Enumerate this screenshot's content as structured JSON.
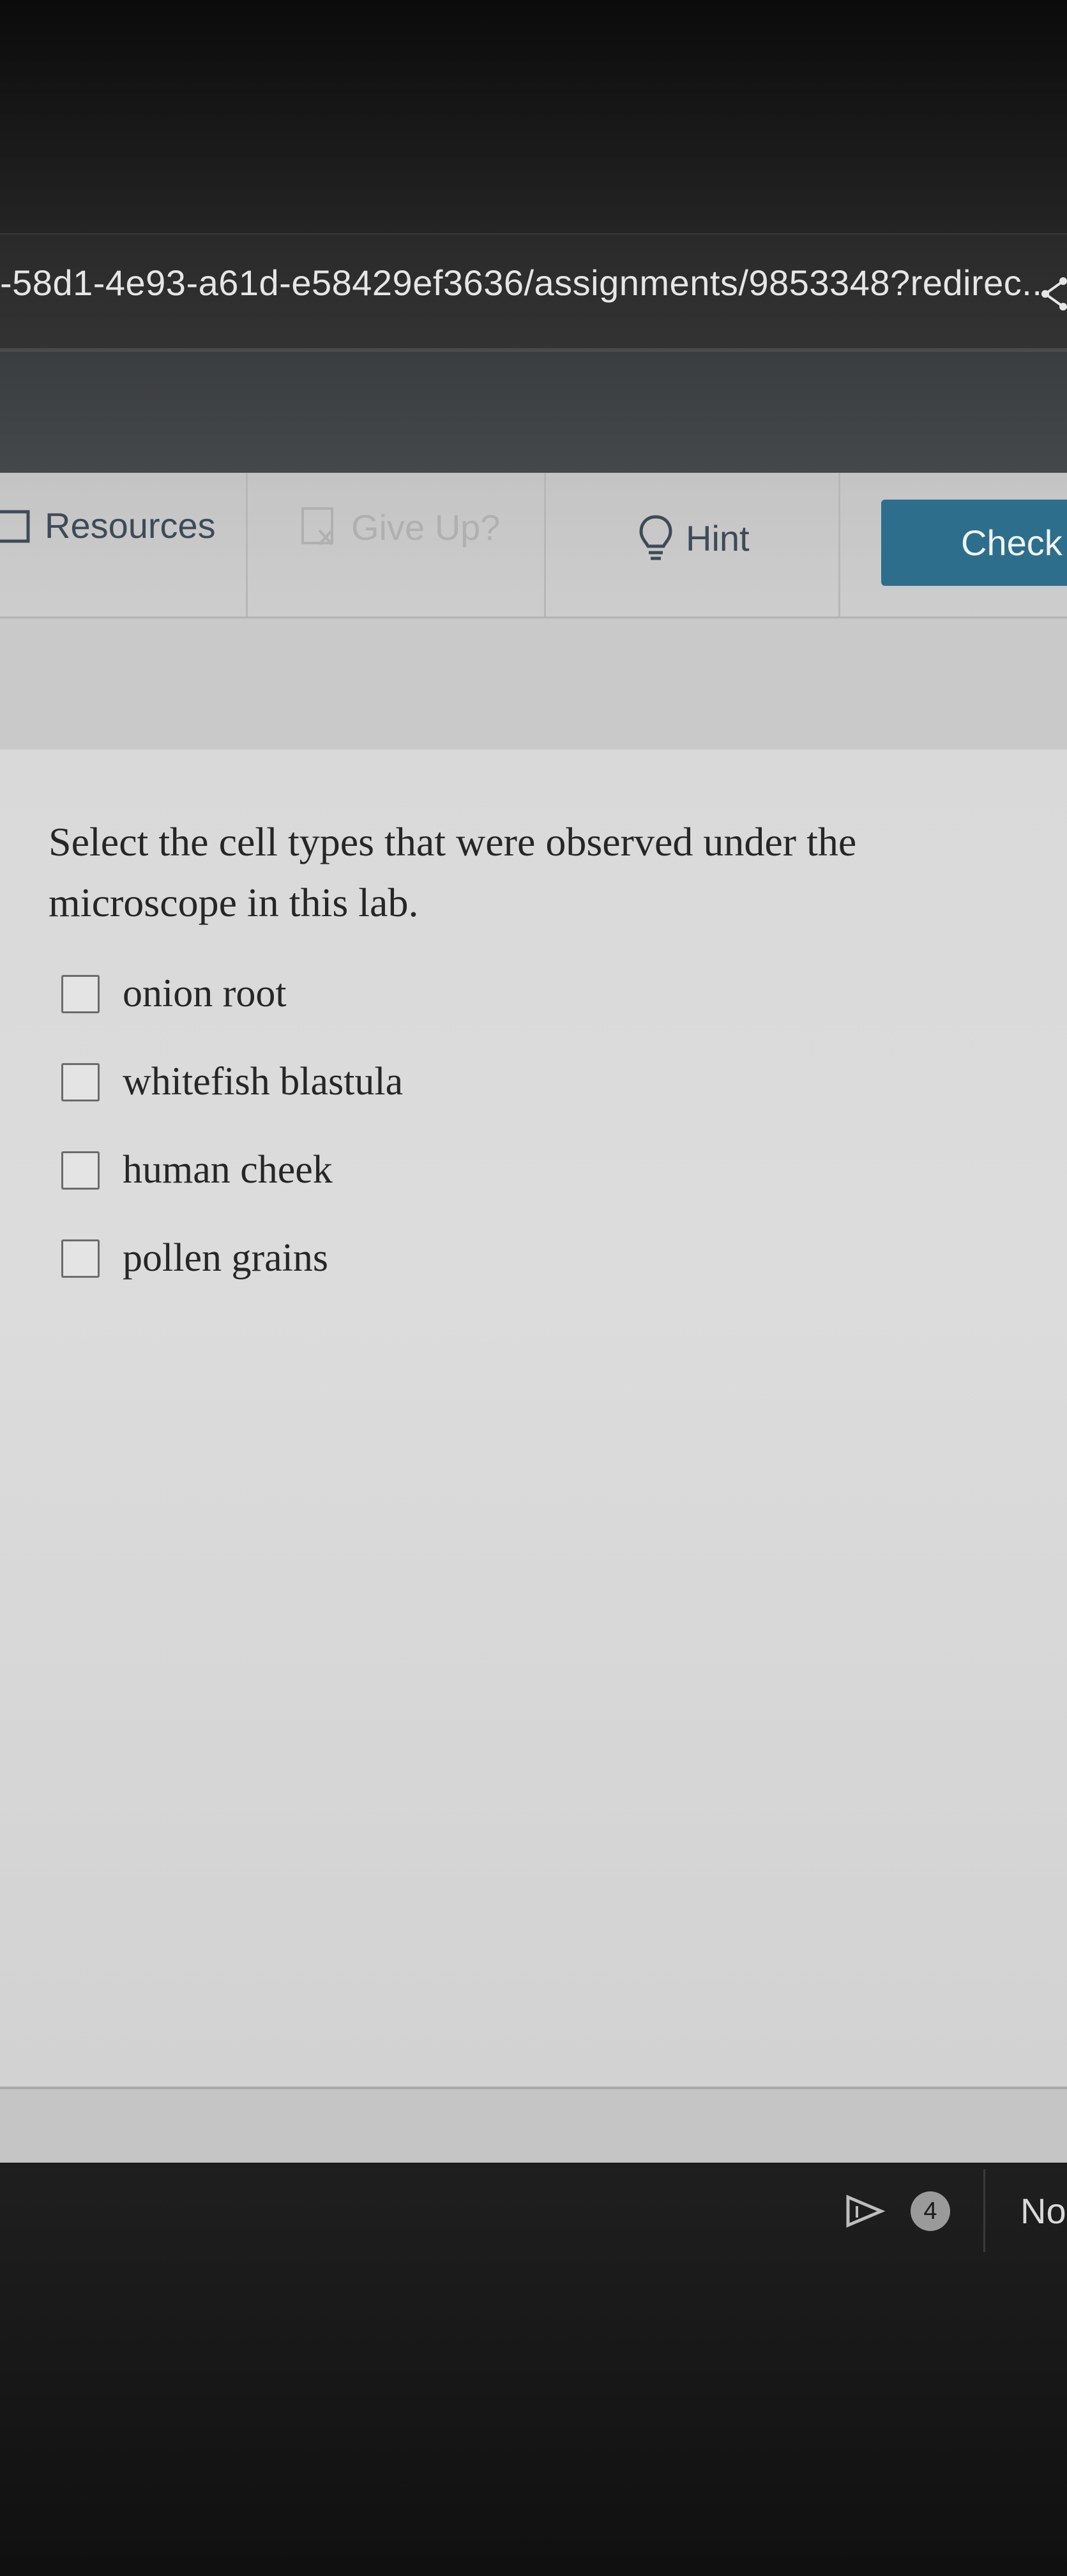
{
  "browser": {
    "url": "-58d1-4e93-a61d-e58429ef3636/assignments/9853348?redirec..."
  },
  "toolbar": {
    "resources_label": "Resources",
    "give_up_label": "Give Up?",
    "hint_label": "Hint",
    "check_label": "Check"
  },
  "question": {
    "prompt": "Select the cell types that were observed under the microscope in this lab.",
    "options": [
      {
        "label": "onion root",
        "checked": false
      },
      {
        "label": "whitefish blastula",
        "checked": false
      },
      {
        "label": "human cheek",
        "checked": false
      },
      {
        "label": "pollen grains",
        "checked": false
      }
    ]
  },
  "footer": {
    "badge_count": "4",
    "next_label": "No"
  },
  "colors": {
    "check_button": "#2d6e8c",
    "toolbar_text": "#3f4a58"
  }
}
